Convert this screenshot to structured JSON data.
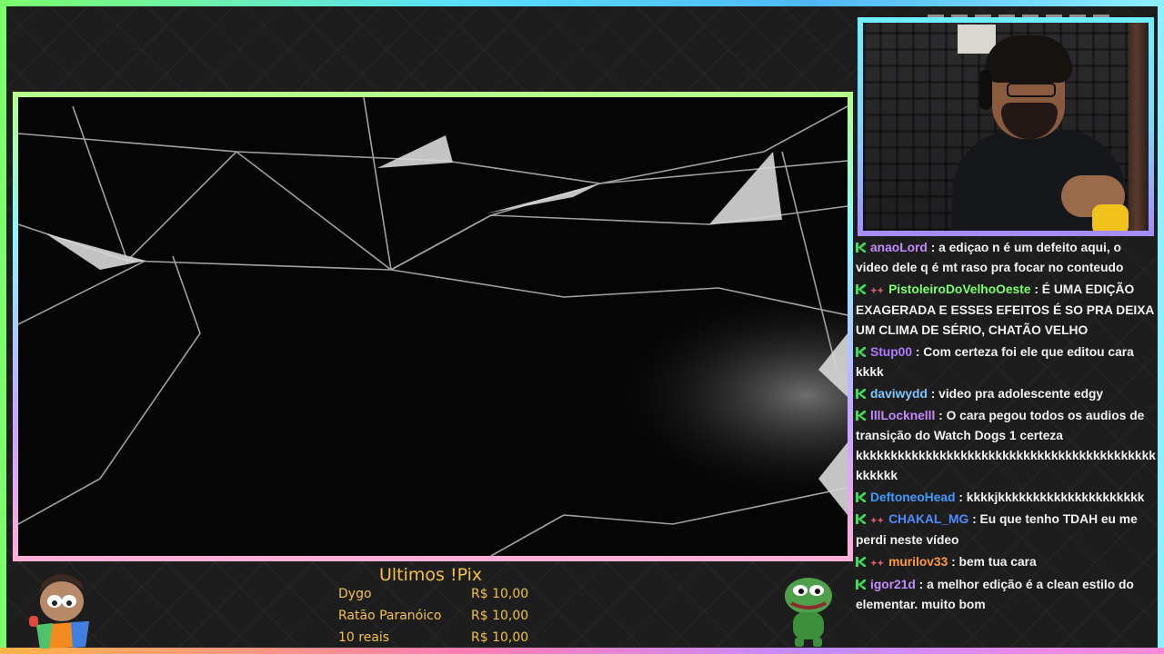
{
  "pix_panel": {
    "title": "Ultimos !Pix",
    "donations": [
      {
        "name": "Dygo",
        "amount": "R$ 10,00"
      },
      {
        "name": "Ratão Paranóico",
        "amount": "R$ 10,00"
      },
      {
        "name": "10 reais",
        "amount": "R$ 10,00"
      }
    ]
  },
  "chat": {
    "messages": [
      {
        "badge": "k-icon",
        "user": "anaoLord",
        "color": "#c38cff",
        "text": "a ediçao n é um defeito aqui, o video dele q é mt raso pra focar no conteudo"
      },
      {
        "badge": "k-icon",
        "badge2": "sub-icon",
        "user": "PistoleiroDoVelhoOeste",
        "color": "#7cff6b",
        "text": "É UMA EDIÇÃO EXAGERADA E ESSES EFEITOS É SO PRA DEIXA UM CLIMA DE SÉRIO, CHATÃO VELHO"
      },
      {
        "badge": "k-icon",
        "user": "Stup00",
        "color": "#b07bff",
        "text": "Com certeza foi ele que editou cara kkkk"
      },
      {
        "badge": "k-icon",
        "user": "daviwydd",
        "color": "#7ec7ff",
        "text": "video pra adolescente edgy"
      },
      {
        "badge": "k-icon",
        "user": "lllLocknelll",
        "color": "#c38cff",
        "text": "O cara pegou todos os audios de transição do Watch Dogs 1 certeza kkkkkkkkkkkkkkkkkkkkkkkkkkkkkkkkkkkkkkkkkkkkkkk kkkkkk"
      },
      {
        "badge": "k-icon",
        "user": "DeftoneoHead",
        "color": "#3f9bff",
        "text": "kkkkjkkkkkkkkkkkkkkkkkkkkk"
      },
      {
        "badge": "k-icon",
        "badge2": "sub-icon",
        "user": "CHAKAL_MG",
        "color": "#4f8cff",
        "text": "Eu que tenho TDAH eu me perdi neste vídeo"
      },
      {
        "badge": "k-icon",
        "badge2": "sub-icon",
        "user": "murilov33",
        "color": "#ff9a3c",
        "text": "bem tua cara"
      },
      {
        "badge": "k-icon",
        "user": "igor21d",
        "color": "#c38cff",
        "text": "a melhor edição é a clean estilo do elementar. muito bom"
      }
    ]
  },
  "colors": {
    "pix_text": "#f3c243",
    "badge_green": "#3ddc5a"
  }
}
